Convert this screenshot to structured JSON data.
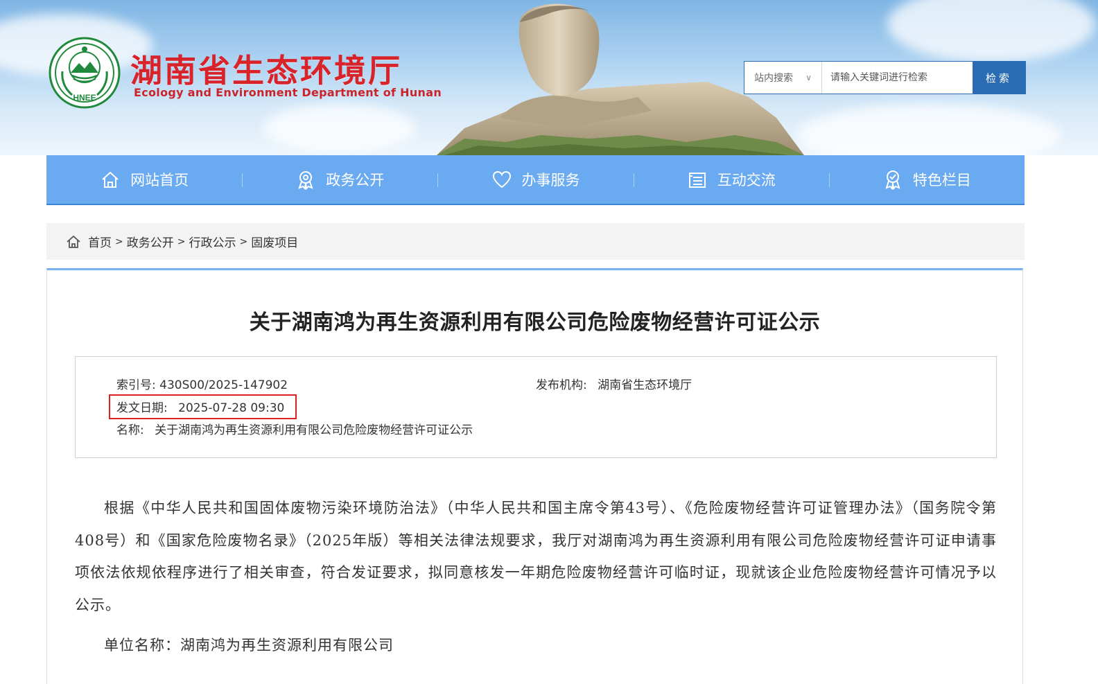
{
  "header": {
    "title_cn": "湖南省生态环境厅",
    "title_en": "Ecology and Environment Department of Hunan",
    "logo_text": "HNEE"
  },
  "search": {
    "scope_label": "站内搜索",
    "scope_arrow": "∨",
    "placeholder": "请输入关键词进行检索",
    "button_label": "检索"
  },
  "nav": {
    "items": [
      {
        "label": "网站首页",
        "icon": "home-icon"
      },
      {
        "label": "政务公开",
        "icon": "badge-icon"
      },
      {
        "label": "办事服务",
        "icon": "heart-icon"
      },
      {
        "label": "互动交流",
        "icon": "document-icon"
      },
      {
        "label": "特色栏目",
        "icon": "ribbon-icon"
      }
    ]
  },
  "breadcrumb": {
    "items": [
      "首页",
      "政务公开",
      "行政公示",
      "固废项目"
    ],
    "separator": ">"
  },
  "article": {
    "title": "关于湖南鸿为再生资源利用有限公司危险废物经营许可证公示",
    "meta": {
      "index_label": "索引号:",
      "index_value": "430S00/2025-147902",
      "publisher_label": "发布机构:",
      "publisher_value": "湖南省生态环境厅",
      "date_label": "发文日期:",
      "date_value": "2025-07-28 09:30",
      "name_label": "名称:",
      "name_value": "关于湖南鸿为再生资源利用有限公司危险废物经营许可证公示"
    },
    "body": "根据《中华人民共和国固体废物污染环境防治法》（中华人民共和国主席令第43号）、《危险废物经营许可证管理办法》（国务院令第408号）和《国家危险废物名录》（2025年版）等相关法律法规要求，我厅对湖南鸿为再生资源利用有限公司危险废物经营许可证申请事项依法依规依程序进行了相关审查，符合发证要求，拟同意核发一年期危险废物经营许可临时证，现就该企业危险废物经营许可情况予以公示。",
    "unit_line": "单位名称：湖南鸿为再生资源利用有限公司"
  },
  "colors": {
    "brand_red": "#d8232a",
    "nav_blue": "#6aaaf0",
    "search_blue": "#2a6cb3",
    "highlight_red": "#e02020"
  }
}
